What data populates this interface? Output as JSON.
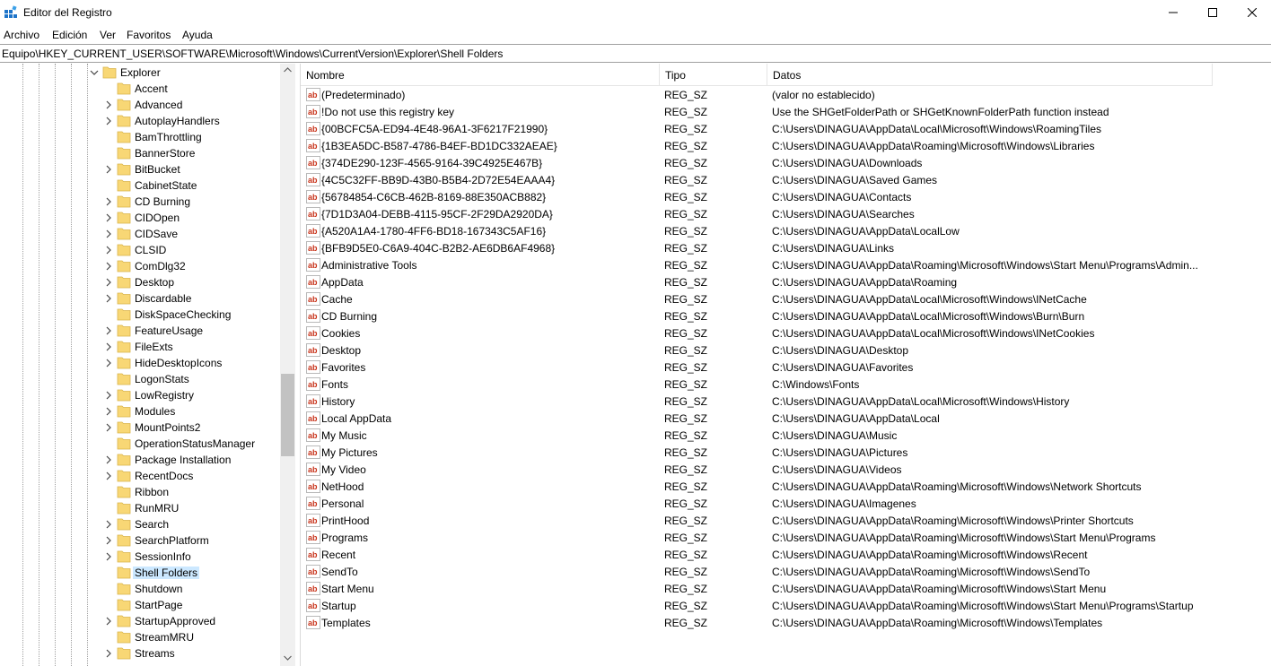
{
  "window": {
    "title": "Editor del Registro"
  },
  "menu": [
    "Archivo",
    "Edición",
    "Ver",
    "Favoritos",
    "Ayuda"
  ],
  "address": "Equipo\\HKEY_CURRENT_USER\\SOFTWARE\\Microsoft\\Windows\\CurrentVersion\\Explorer\\Shell Folders",
  "tree": {
    "parent": "Explorer",
    "children": [
      {
        "label": "Accent",
        "expandable": false
      },
      {
        "label": "Advanced",
        "expandable": true
      },
      {
        "label": "AutoplayHandlers",
        "expandable": true
      },
      {
        "label": "BamThrottling",
        "expandable": false
      },
      {
        "label": "BannerStore",
        "expandable": false
      },
      {
        "label": "BitBucket",
        "expandable": true
      },
      {
        "label": "CabinetState",
        "expandable": false
      },
      {
        "label": "CD Burning",
        "expandable": true
      },
      {
        "label": "CIDOpen",
        "expandable": true
      },
      {
        "label": "CIDSave",
        "expandable": true
      },
      {
        "label": "CLSID",
        "expandable": true
      },
      {
        "label": "ComDlg32",
        "expandable": true
      },
      {
        "label": "Desktop",
        "expandable": true
      },
      {
        "label": "Discardable",
        "expandable": true
      },
      {
        "label": "DiskSpaceChecking",
        "expandable": false
      },
      {
        "label": "FeatureUsage",
        "expandable": true
      },
      {
        "label": "FileExts",
        "expandable": true
      },
      {
        "label": "HideDesktopIcons",
        "expandable": true
      },
      {
        "label": "LogonStats",
        "expandable": false
      },
      {
        "label": "LowRegistry",
        "expandable": true
      },
      {
        "label": "Modules",
        "expandable": true
      },
      {
        "label": "MountPoints2",
        "expandable": true
      },
      {
        "label": "OperationStatusManager",
        "expandable": false
      },
      {
        "label": "Package Installation",
        "expandable": true
      },
      {
        "label": "RecentDocs",
        "expandable": true
      },
      {
        "label": "Ribbon",
        "expandable": false
      },
      {
        "label": "RunMRU",
        "expandable": false
      },
      {
        "label": "Search",
        "expandable": true
      },
      {
        "label": "SearchPlatform",
        "expandable": true
      },
      {
        "label": "SessionInfo",
        "expandable": true
      },
      {
        "label": "Shell Folders",
        "expandable": false,
        "selected": true
      },
      {
        "label": "Shutdown",
        "expandable": false
      },
      {
        "label": "StartPage",
        "expandable": false
      },
      {
        "label": "StartupApproved",
        "expandable": true
      },
      {
        "label": "StreamMRU",
        "expandable": false
      },
      {
        "label": "Streams",
        "expandable": true
      }
    ]
  },
  "columns": [
    "Nombre",
    "Tipo",
    "Datos"
  ],
  "values": [
    {
      "name": "(Predeterminado)",
      "type": "REG_SZ",
      "data": "(valor no establecido)"
    },
    {
      "name": "!Do not use this registry key",
      "type": "REG_SZ",
      "data": "Use the SHGetFolderPath or SHGetKnownFolderPath function instead"
    },
    {
      "name": "{00BCFC5A-ED94-4E48-96A1-3F6217F21990}",
      "type": "REG_SZ",
      "data": "C:\\Users\\DINAGUA\\AppData\\Local\\Microsoft\\Windows\\RoamingTiles"
    },
    {
      "name": "{1B3EA5DC-B587-4786-B4EF-BD1DC332AEAE}",
      "type": "REG_SZ",
      "data": "C:\\Users\\DINAGUA\\AppData\\Roaming\\Microsoft\\Windows\\Libraries"
    },
    {
      "name": "{374DE290-123F-4565-9164-39C4925E467B}",
      "type": "REG_SZ",
      "data": "C:\\Users\\DINAGUA\\Downloads"
    },
    {
      "name": "{4C5C32FF-BB9D-43B0-B5B4-2D72E54EAAA4}",
      "type": "REG_SZ",
      "data": "C:\\Users\\DINAGUA\\Saved Games"
    },
    {
      "name": "{56784854-C6CB-462B-8169-88E350ACB882}",
      "type": "REG_SZ",
      "data": "C:\\Users\\DINAGUA\\Contacts"
    },
    {
      "name": "{7D1D3A04-DEBB-4115-95CF-2F29DA2920DA}",
      "type": "REG_SZ",
      "data": "C:\\Users\\DINAGUA\\Searches"
    },
    {
      "name": "{A520A1A4-1780-4FF6-BD18-167343C5AF16}",
      "type": "REG_SZ",
      "data": "C:\\Users\\DINAGUA\\AppData\\LocalLow"
    },
    {
      "name": "{BFB9D5E0-C6A9-404C-B2B2-AE6DB6AF4968}",
      "type": "REG_SZ",
      "data": "C:\\Users\\DINAGUA\\Links"
    },
    {
      "name": "Administrative Tools",
      "type": "REG_SZ",
      "data": "C:\\Users\\DINAGUA\\AppData\\Roaming\\Microsoft\\Windows\\Start Menu\\Programs\\Admin..."
    },
    {
      "name": "AppData",
      "type": "REG_SZ",
      "data": "C:\\Users\\DINAGUA\\AppData\\Roaming"
    },
    {
      "name": "Cache",
      "type": "REG_SZ",
      "data": "C:\\Users\\DINAGUA\\AppData\\Local\\Microsoft\\Windows\\INetCache"
    },
    {
      "name": "CD Burning",
      "type": "REG_SZ",
      "data": "C:\\Users\\DINAGUA\\AppData\\Local\\Microsoft\\Windows\\Burn\\Burn"
    },
    {
      "name": "Cookies",
      "type": "REG_SZ",
      "data": "C:\\Users\\DINAGUA\\AppData\\Local\\Microsoft\\Windows\\INetCookies"
    },
    {
      "name": "Desktop",
      "type": "REG_SZ",
      "data": "C:\\Users\\DINAGUA\\Desktop"
    },
    {
      "name": "Favorites",
      "type": "REG_SZ",
      "data": "C:\\Users\\DINAGUA\\Favorites"
    },
    {
      "name": "Fonts",
      "type": "REG_SZ",
      "data": "C:\\Windows\\Fonts"
    },
    {
      "name": "History",
      "type": "REG_SZ",
      "data": "C:\\Users\\DINAGUA\\AppData\\Local\\Microsoft\\Windows\\History"
    },
    {
      "name": "Local AppData",
      "type": "REG_SZ",
      "data": "C:\\Users\\DINAGUA\\AppData\\Local"
    },
    {
      "name": "My Music",
      "type": "REG_SZ",
      "data": "C:\\Users\\DINAGUA\\Music"
    },
    {
      "name": "My Pictures",
      "type": "REG_SZ",
      "data": "C:\\Users\\DINAGUA\\Pictures"
    },
    {
      "name": "My Video",
      "type": "REG_SZ",
      "data": "C:\\Users\\DINAGUA\\Videos"
    },
    {
      "name": "NetHood",
      "type": "REG_SZ",
      "data": "C:\\Users\\DINAGUA\\AppData\\Roaming\\Microsoft\\Windows\\Network Shortcuts"
    },
    {
      "name": "Personal",
      "type": "REG_SZ",
      "data": "C:\\Users\\DINAGUA\\Imagenes"
    },
    {
      "name": "PrintHood",
      "type": "REG_SZ",
      "data": "C:\\Users\\DINAGUA\\AppData\\Roaming\\Microsoft\\Windows\\Printer Shortcuts"
    },
    {
      "name": "Programs",
      "type": "REG_SZ",
      "data": "C:\\Users\\DINAGUA\\AppData\\Roaming\\Microsoft\\Windows\\Start Menu\\Programs"
    },
    {
      "name": "Recent",
      "type": "REG_SZ",
      "data": "C:\\Users\\DINAGUA\\AppData\\Roaming\\Microsoft\\Windows\\Recent"
    },
    {
      "name": "SendTo",
      "type": "REG_SZ",
      "data": "C:\\Users\\DINAGUA\\AppData\\Roaming\\Microsoft\\Windows\\SendTo"
    },
    {
      "name": "Start Menu",
      "type": "REG_SZ",
      "data": "C:\\Users\\DINAGUA\\AppData\\Roaming\\Microsoft\\Windows\\Start Menu"
    },
    {
      "name": "Startup",
      "type": "REG_SZ",
      "data": "C:\\Users\\DINAGUA\\AppData\\Roaming\\Microsoft\\Windows\\Start Menu\\Programs\\Startup"
    },
    {
      "name": "Templates",
      "type": "REG_SZ",
      "data": "C:\\Users\\DINAGUA\\AppData\\Roaming\\Microsoft\\Windows\\Templates"
    }
  ],
  "colors": {
    "selection": "#cce8ff",
    "folder": "#f8d775",
    "ab_icon": "#c8331a"
  },
  "icons": {
    "app": "registry-editor-icon",
    "folder": "folder-icon",
    "string_value": "string-value-icon"
  }
}
